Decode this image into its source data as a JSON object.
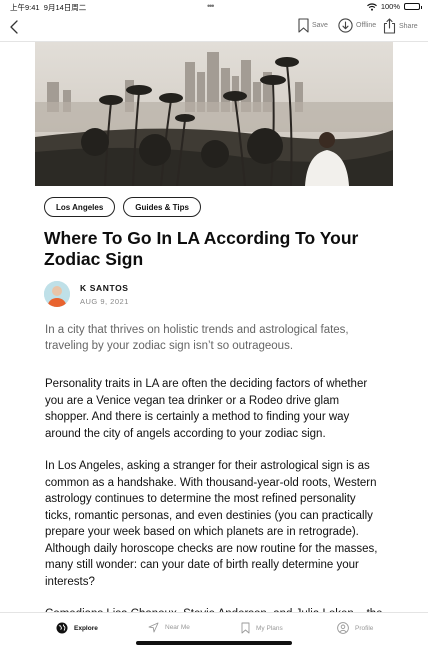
{
  "status_bar": {
    "time": "上午9:41",
    "date": "9月14日周二",
    "battery": "100%"
  },
  "nav": {
    "save_label": "Save",
    "offline_label": "Offline",
    "share_label": "Share"
  },
  "tags": [
    {
      "label": "Los Angeles"
    },
    {
      "label": "Guides & Tips"
    }
  ],
  "article": {
    "title": "Where To Go In LA According To Your Zodiac Sign",
    "author_name": "K SANTOS",
    "date": "AUG 9, 2021",
    "lede": "In a city that thrives on holistic trends and astrological fates, traveling by your zodiac sign isn’t so outrageous.",
    "paragraphs": [
      "Personality traits in LA are often the deciding factors of whether you are a Venice vegan tea drinker or a Rodeo drive glam shopper. And there is certainly a method to finding your way around the city of angels according to your zodiac sign.",
      "In Los Angeles, asking a stranger for their astrological sign is as common as a handshake. With thousand-year-old roots, Western astrology continues to determine the most refined personality ticks, romantic personas, and even destinies (you can practically prepare your week based on which planets are in retrograde). Although daily horoscope checks are now routine for the masses, many still wonder: can your date of birth really determine your interests?",
      "Comedians Lisa Chanoux, Stevie Anderson, and Julia Loken – the"
    ]
  },
  "tab_bar": {
    "explore": "Explore",
    "near_me": "Near Me",
    "my_plans": "My Plans",
    "profile": "Profile"
  }
}
